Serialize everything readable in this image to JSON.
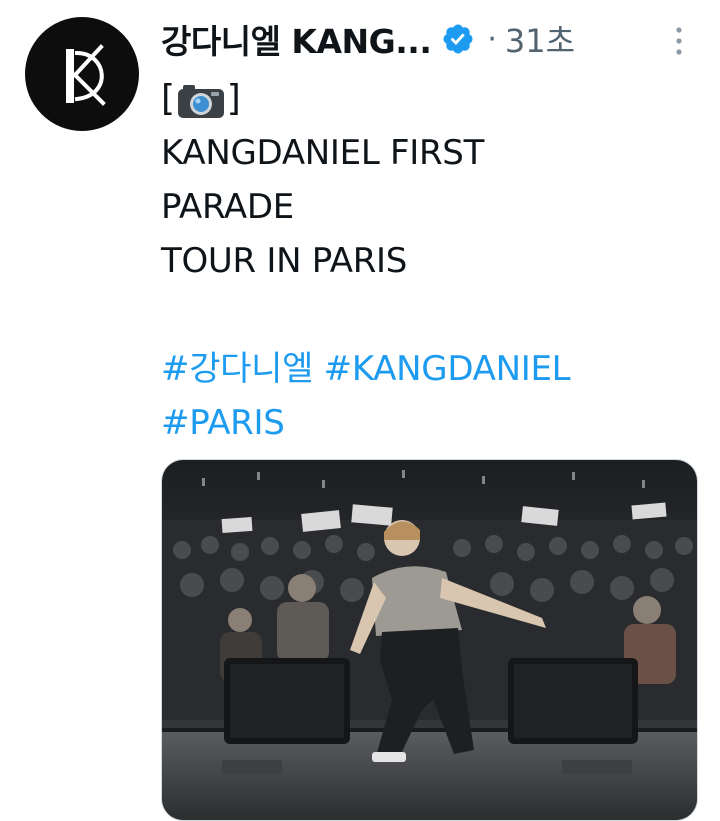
{
  "tweet": {
    "author_name": "강다니엘 KANG...",
    "timestamp": "31초",
    "text_lines": [
      "[",
      "]",
      "KANGDANIEL FIRST",
      "PARADE",
      "TOUR IN PARIS"
    ],
    "hashtags": [
      "#강다니엘",
      "#KANGDANIEL",
      "#PARIS"
    ],
    "icons": {
      "verified": "verified-badge-icon",
      "camera": "camera-emoji-icon",
      "more": "more-options-icon"
    },
    "colors": {
      "link": "#1d9bf0",
      "verified": "#1d9bf0",
      "secondary": "#536471"
    }
  }
}
